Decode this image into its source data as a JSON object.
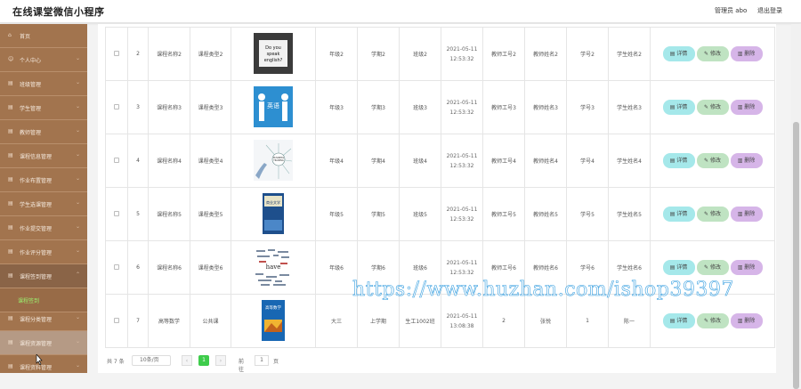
{
  "header": {
    "app_title": "在线课堂微信小程序",
    "admin_label": "管理员 abo",
    "logout_label": "退出登录"
  },
  "sidebar": {
    "items": [
      {
        "label": "首页",
        "icon": "home-icon"
      },
      {
        "label": "个人中心",
        "icon": "user-icon"
      },
      {
        "label": "班级管理",
        "icon": "class-icon"
      },
      {
        "label": "学生管理",
        "icon": "student-icon"
      },
      {
        "label": "教师管理",
        "icon": "teacher-icon"
      },
      {
        "label": "课程信息管理",
        "icon": "course-icon"
      },
      {
        "label": "作业布置管理",
        "icon": "homework-icon"
      },
      {
        "label": "学生选课管理",
        "icon": "select-icon"
      },
      {
        "label": "作业提交管理",
        "icon": "submit-icon"
      },
      {
        "label": "作业评分管理",
        "icon": "score-icon"
      },
      {
        "label": "课程签到管理",
        "icon": "checkin-icon"
      },
      {
        "label": "课程签到",
        "icon": ""
      },
      {
        "label": "课程分类管理",
        "icon": "category-icon"
      },
      {
        "label": "课程资源管理",
        "icon": "resource-icon"
      },
      {
        "label": "课程资料管理",
        "icon": "material-icon"
      }
    ]
  },
  "table": {
    "rows": [
      {
        "no": "2",
        "name": "课程名称2",
        "type": "课程类型2",
        "image": "do-you-speak-english",
        "grade": "年级2",
        "term": "学期2",
        "class": "班级2",
        "time": "2021-05-11 12:53:32",
        "teacher_id": "教师工号2",
        "teacher_name": "教师姓名2",
        "student_id": "学号2",
        "student_name": "学生姓名2"
      },
      {
        "no": "3",
        "name": "课程名称3",
        "type": "课程类型3",
        "image": "english-learning",
        "grade": "年级3",
        "term": "学期3",
        "class": "班级3",
        "time": "2021-05-11 12:53:32",
        "teacher_id": "教师工号3",
        "teacher_name": "教师姓名3",
        "student_id": "学号3",
        "student_name": "学生姓名3"
      },
      {
        "no": "4",
        "name": "课程名称4",
        "type": "课程类型4",
        "image": "business-training",
        "grade": "年级4",
        "term": "学期4",
        "class": "班级4",
        "time": "2021-05-11 12:53:32",
        "teacher_id": "教师工号4",
        "teacher_name": "教师姓名4",
        "student_id": "学号4",
        "student_name": "学生姓名4"
      },
      {
        "no": "5",
        "name": "课程名称5",
        "type": "课程类型5",
        "image": "book-cover",
        "grade": "年级5",
        "term": "学期5",
        "class": "班级5",
        "time": "2021-05-11 12:53:32",
        "teacher_id": "教师工号5",
        "teacher_name": "教师姓名5",
        "student_id": "学号5",
        "student_name": "学生姓名5"
      },
      {
        "no": "6",
        "name": "课程名称6",
        "type": "课程类型6",
        "image": "word-cloud",
        "grade": "年级6",
        "term": "学期6",
        "class": "班级6",
        "time": "2021-05-11 12:53:32",
        "teacher_id": "教师工号6",
        "teacher_name": "教师姓名6",
        "student_id": "学号6",
        "student_name": "学生姓名6"
      },
      {
        "no": "7",
        "name": "高等数学",
        "type": "公共课",
        "image": "math-book",
        "grade": "大三",
        "term": "上学期",
        "class": "生工1002班",
        "time": "2021-05-11 13:08:38",
        "teacher_id": "2",
        "teacher_name": "张悦",
        "student_id": "1",
        "student_name": "陈一"
      }
    ],
    "buttons": {
      "detail": "详情",
      "edit": "修改",
      "delete": "删除"
    },
    "image_texts": {
      "do_you_speak": "Do you speak english?",
      "english": "英语",
      "business": "BUSINESS TRAINING",
      "book_title": "商业文学",
      "math_title": "高等数学",
      "word_cloud": "have"
    }
  },
  "pagination": {
    "total": "共 7 条",
    "page_size": "10条/页",
    "current": "1",
    "goto_label": "前往",
    "goto_value": "1",
    "unit": "页",
    "prev": "‹",
    "next": "›"
  },
  "watermark": "https://www.huzhan.com/ishop39397",
  "colors": {
    "sidebar": "#a2744e",
    "detail": "#a5e8ea",
    "edit": "#bfe3c2",
    "delete": "#d6b5e8",
    "page_active": "#3ecc4b"
  }
}
